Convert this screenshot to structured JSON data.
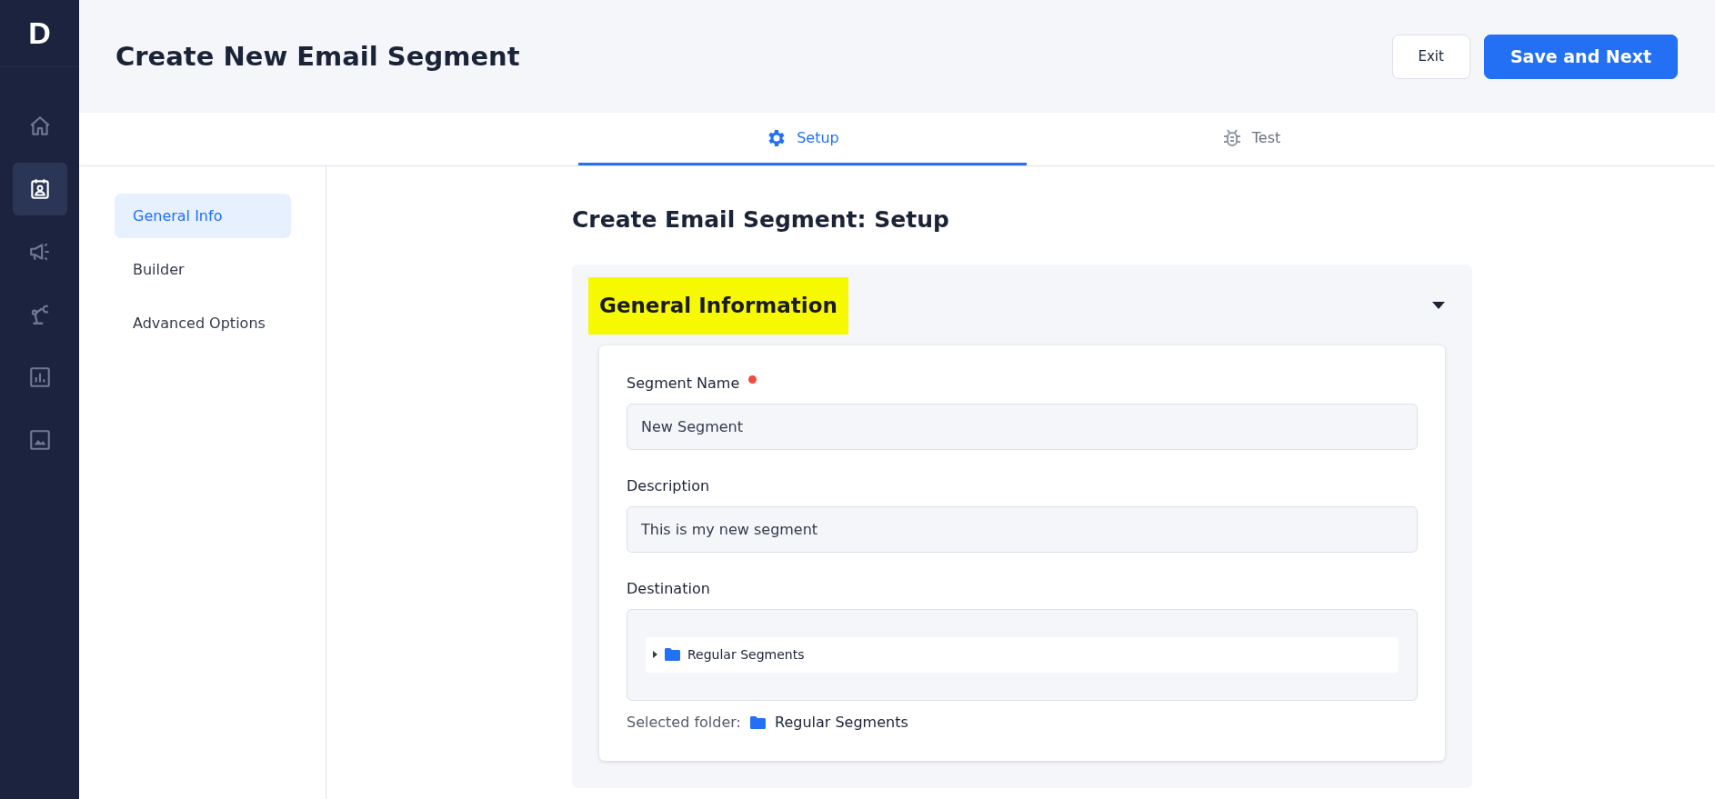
{
  "app": {
    "logo": "D"
  },
  "sidebar": {
    "items": [
      {
        "kind": "home",
        "selected": false
      },
      {
        "kind": "contacts",
        "selected": true
      },
      {
        "kind": "megaphone",
        "selected": false
      },
      {
        "kind": "robot",
        "selected": false
      },
      {
        "kind": "chart",
        "selected": false
      },
      {
        "kind": "image",
        "selected": false
      }
    ]
  },
  "header": {
    "title": "Create New Email Segment",
    "buttons": [
      {
        "label": "Exit",
        "kind": "secondary"
      },
      {
        "label": "Save and Next",
        "kind": "primary"
      }
    ]
  },
  "tabs": [
    {
      "label": "Setup",
      "kind": "gear",
      "selected": true
    },
    {
      "label": "Test",
      "kind": "bug",
      "selected": false
    }
  ],
  "section_nav": [
    {
      "label": "General Info",
      "selected": true
    },
    {
      "label": "Builder",
      "selected": false
    },
    {
      "label": "Advanced Options",
      "selected": false
    }
  ],
  "content": {
    "title": "Create Email Segment: Setup",
    "panel": {
      "title": "General Information",
      "highlighted": true,
      "expanded": true,
      "fields": [
        {
          "label": "Segment Name",
          "required": true,
          "value": "New Segment"
        },
        {
          "label": "Description",
          "required": false,
          "value": "This is my new segment"
        }
      ],
      "destination": {
        "label": "Destination",
        "tree": [
          {
            "label": "Regular Segments",
            "expanded": false
          }
        ],
        "selected_label": "Selected folder:",
        "selected_folder": "Regular Segments"
      }
    }
  }
}
